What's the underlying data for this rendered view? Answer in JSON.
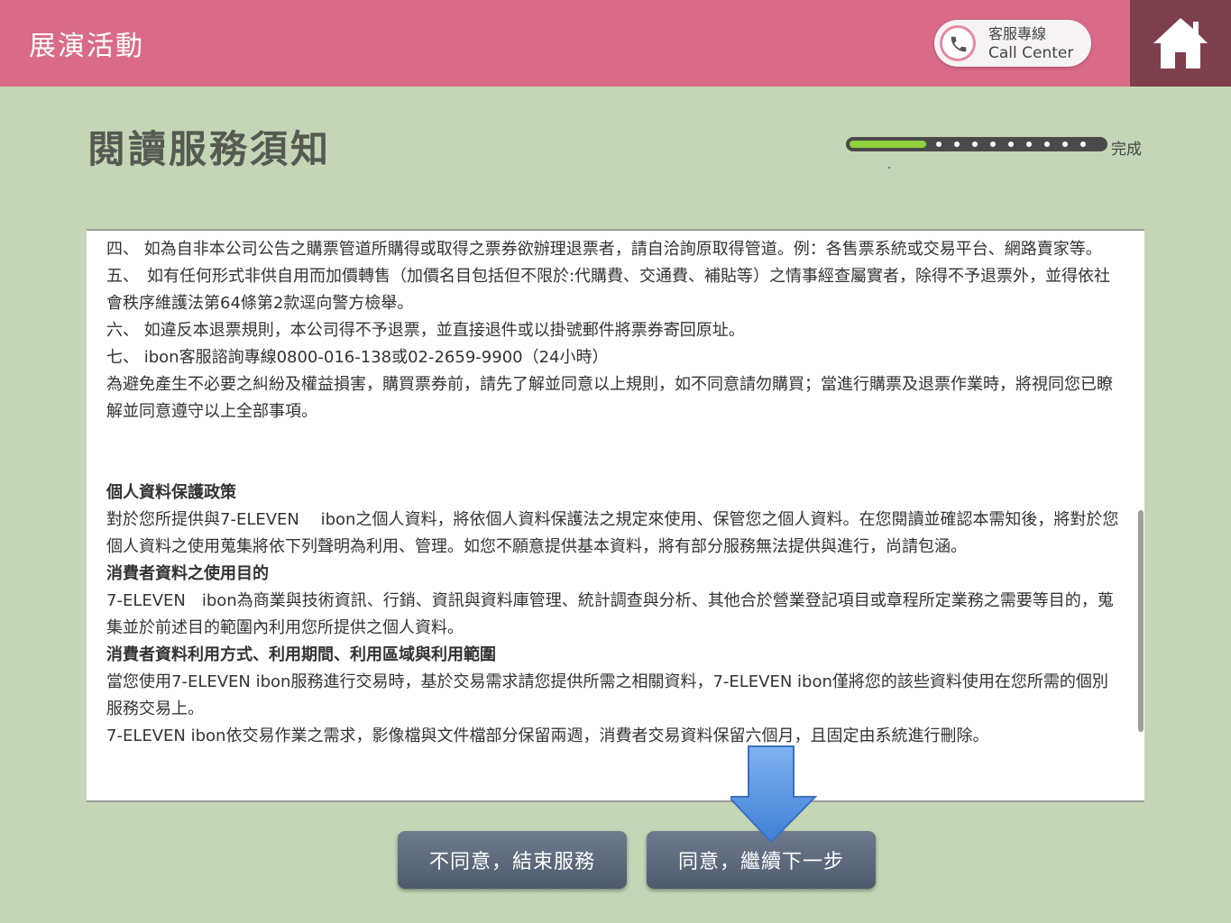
{
  "header": {
    "title": "展演活動",
    "call_center_line1": "客服專線",
    "call_center_line2": "Call Center"
  },
  "page": {
    "title": "閱讀服務須知",
    "progress_label": "完成",
    "progress_fraction": 0.3
  },
  "notice": {
    "paragraphs": [
      {
        "type": "text",
        "text": "四、 如為自非本公司公告之購票管道所購得或取得之票券欲辦理退票者，請自洽詢原取得管道。例：各售票系統或交易平台、網路賣家等。"
      },
      {
        "type": "text",
        "text": "五、　如有任何形式非供自用而加價轉售（加價名目包括但不限於:代購費、交通費、補貼等）之情事經查屬實者，除得不予退票外，並得依社會秩序維護法第64條第2款逕向警方檢舉。"
      },
      {
        "type": "text",
        "text": "六、 如違反本退票規則，本公司得不予退票，並直接退件或以掛號郵件將票券寄回原址。"
      },
      {
        "type": "text",
        "text": "七、 ibon客服諮詢專線0800-016-138或02-2659-9900（24小時）"
      },
      {
        "type": "text",
        "text": "為避免產生不必要之糾紛及權益損害，購買票券前，請先了解並同意以上規則，如不同意請勿購買；當進行購票及退票作業時，將視同您已瞭解並同意遵守以上全部事項。"
      },
      {
        "type": "gap",
        "text": ""
      },
      {
        "type": "head",
        "text": "個人資料保護政策"
      },
      {
        "type": "text",
        "text": "對於您所提供與7-ELEVEN　 ibon之個人資料，將依個人資料保護法之規定來使用、保管您之個人資料。在您閱讀並確認本需知後，將對於您個人資料之使用蒐集將依下列聲明為利用、管理。如您不願意提供基本資料，將有部分服務無法提供與進行，尚請包涵。"
      },
      {
        "type": "head",
        "text": "消費者資料之使用目的"
      },
      {
        "type": "text",
        "text": "7-ELEVEN　ibon為商業與技術資訊、行銷、資訊與資料庫管理、統計調查與分析、其他合於營業登記項目或章程所定業務之需要等目的，蒐集並於前述目的範圍內利用您所提供之個人資料。"
      },
      {
        "type": "head",
        "text": "消費者資料利用方式、利用期間、利用區域與利用範圍"
      },
      {
        "type": "text",
        "text": "當您使用7-ELEVEN ibon服務進行交易時，基於交易需求請您提供所需之相關資料，7-ELEVEN ibon僅將您的該些資料使用在您所需的個別服務交易上。"
      },
      {
        "type": "text",
        "text": "7-ELEVEN ibon依交易作業之需求，影像檔與文件檔部分保留兩週，消費者交易資料保留六個月，且固定由系統進行刪除。"
      }
    ]
  },
  "buttons": {
    "disagree": "不同意，結束服務",
    "agree": "同意，繼續下一步"
  },
  "icons": {
    "call": "phone-icon",
    "home": "home-icon",
    "arrow": "down-arrow-icon"
  },
  "colors": {
    "header_bg": "#d96b88",
    "home_bg": "#7e3f4c",
    "page_bg": "#c5d6b6",
    "progress_fill": "#8ed23d",
    "button_bg": "#5f697c",
    "arrow_fill": "#4f8fe0"
  }
}
